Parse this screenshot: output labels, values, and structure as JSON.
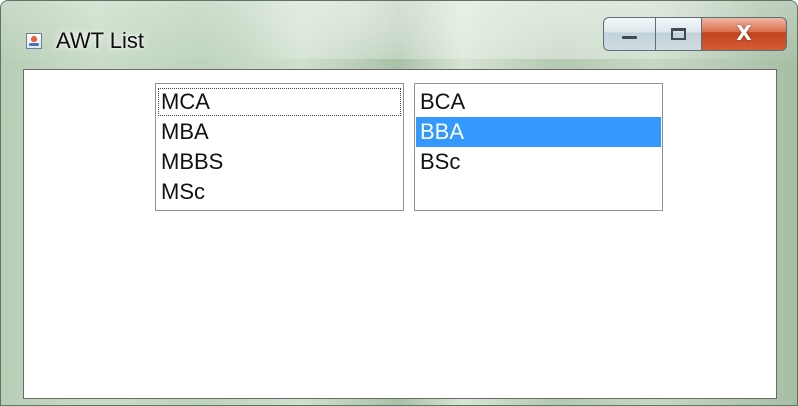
{
  "window": {
    "title": "AWT List",
    "icon": "java-app-icon",
    "controls": {
      "minimize_icon": "minimize-icon",
      "maximize_icon": "maximize-icon",
      "close_icon": "close-icon",
      "close_label": "X"
    },
    "colors": {
      "selection": "#3399ff",
      "close_button": "#d45d35"
    }
  },
  "lists": [
    {
      "items": [
        "MCA",
        "MBA",
        "MBBS",
        "MSc"
      ],
      "focused_item": "MCA"
    },
    {
      "items": [
        "BCA",
        "BBA",
        "BSc"
      ],
      "selected_item": "BBA"
    }
  ]
}
